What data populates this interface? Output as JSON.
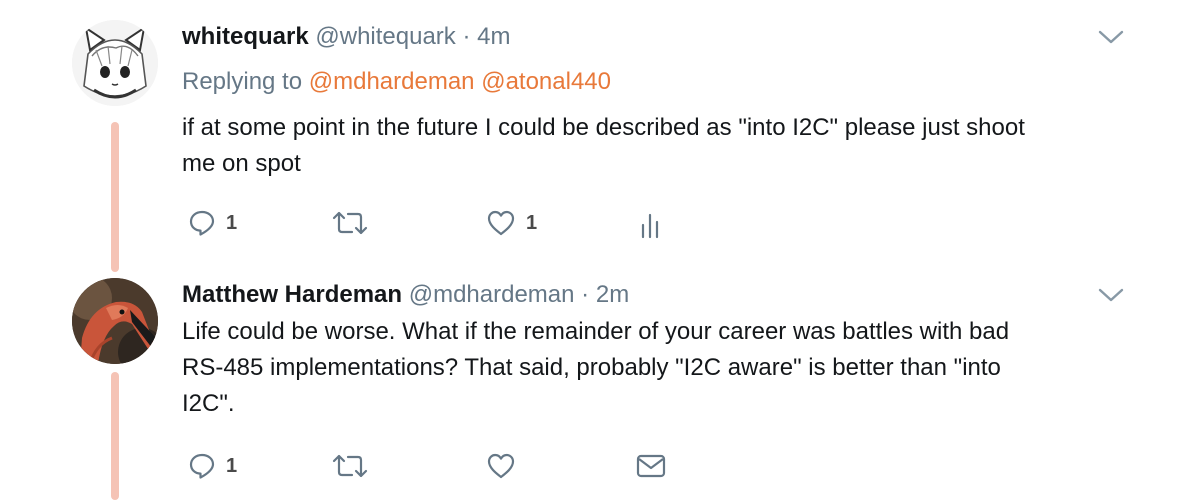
{
  "tweets": [
    {
      "fullname": "whitequark",
      "username": "@whitequark",
      "separator": "·",
      "time": "4m",
      "replying_prefix": "Replying to",
      "mentions": [
        "@mdhardeman",
        "@atonal440"
      ],
      "text_lines": [
        "if at some point in the future I could be described as \"into I2C\" please just shoot",
        "me on spot"
      ],
      "reply_count": "1",
      "like_count": "1",
      "avatar_icon": "anime-cat-girl-avatar"
    },
    {
      "fullname": "Matthew Hardeman",
      "username": "@mdhardeman",
      "separator": "·",
      "time": "2m",
      "text_lines": [
        "Life could be worse.  What if the remainder of your career was battles with bad",
        "RS-485 implementations?  That said, probably \"I2C aware\" is better than \"into",
        "I2C\"."
      ],
      "reply_count": "1",
      "avatar_icon": "flamingo-avatar"
    }
  ],
  "colors": {
    "accent_mention": "#e8793a",
    "thread_line": "#f5c3b5",
    "secondary_text": "#657786",
    "icon_gray": "#657786"
  }
}
